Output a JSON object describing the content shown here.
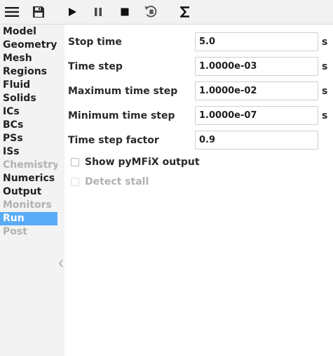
{
  "toolbar": {
    "buttons": [
      {
        "name": "menu",
        "icon": "hamburger-menu-icon"
      },
      {
        "name": "save",
        "icon": "floppy-disk-icon"
      },
      {
        "name": "run",
        "icon": "play-icon"
      },
      {
        "name": "pause",
        "icon": "pause-icon"
      },
      {
        "name": "stop",
        "icon": "stop-icon"
      },
      {
        "name": "reset",
        "icon": "reset-icon"
      },
      {
        "name": "parameters",
        "icon": "sigma-icon"
      }
    ]
  },
  "sidebar": {
    "items": [
      {
        "label": "Model",
        "state": "normal"
      },
      {
        "label": "Geometry",
        "state": "normal"
      },
      {
        "label": "Mesh",
        "state": "normal"
      },
      {
        "label": "Regions",
        "state": "normal"
      },
      {
        "label": "Fluid",
        "state": "normal"
      },
      {
        "label": "Solids",
        "state": "normal"
      },
      {
        "label": "ICs",
        "state": "normal"
      },
      {
        "label": "BCs",
        "state": "normal"
      },
      {
        "label": "PSs",
        "state": "normal"
      },
      {
        "label": "ISs",
        "state": "normal"
      },
      {
        "label": "Chemistry",
        "state": "disabled"
      },
      {
        "label": "Numerics",
        "state": "normal"
      },
      {
        "label": "Output",
        "state": "normal"
      },
      {
        "label": "Monitors",
        "state": "disabled"
      },
      {
        "label": "Run",
        "state": "selected"
      },
      {
        "label": "Post",
        "state": "disabled"
      }
    ],
    "splitter_icon": "chevron-left-icon"
  },
  "run_pane": {
    "fields": [
      {
        "label": "Stop time",
        "value": "5.0",
        "unit": "s"
      },
      {
        "label": "Time step",
        "value": "1.0000e-03",
        "unit": "s"
      },
      {
        "label": "Maximum time step",
        "value": "1.0000e-02",
        "unit": "s"
      },
      {
        "label": "Minimum time step",
        "value": "1.0000e-07",
        "unit": "s"
      },
      {
        "label": "Time step factor",
        "value": "0.9",
        "unit": ""
      }
    ],
    "checkboxes": [
      {
        "label": "Show pyMFiX output",
        "checked": false,
        "enabled": true
      },
      {
        "label": "Detect stall",
        "checked": false,
        "enabled": false
      }
    ]
  },
  "colors": {
    "selection": "#5aacf6",
    "disabled_text": "#b2b2b2",
    "sidebar_bg": "#f3f3f3",
    "toolbar_bg": "#f2f2f2"
  }
}
